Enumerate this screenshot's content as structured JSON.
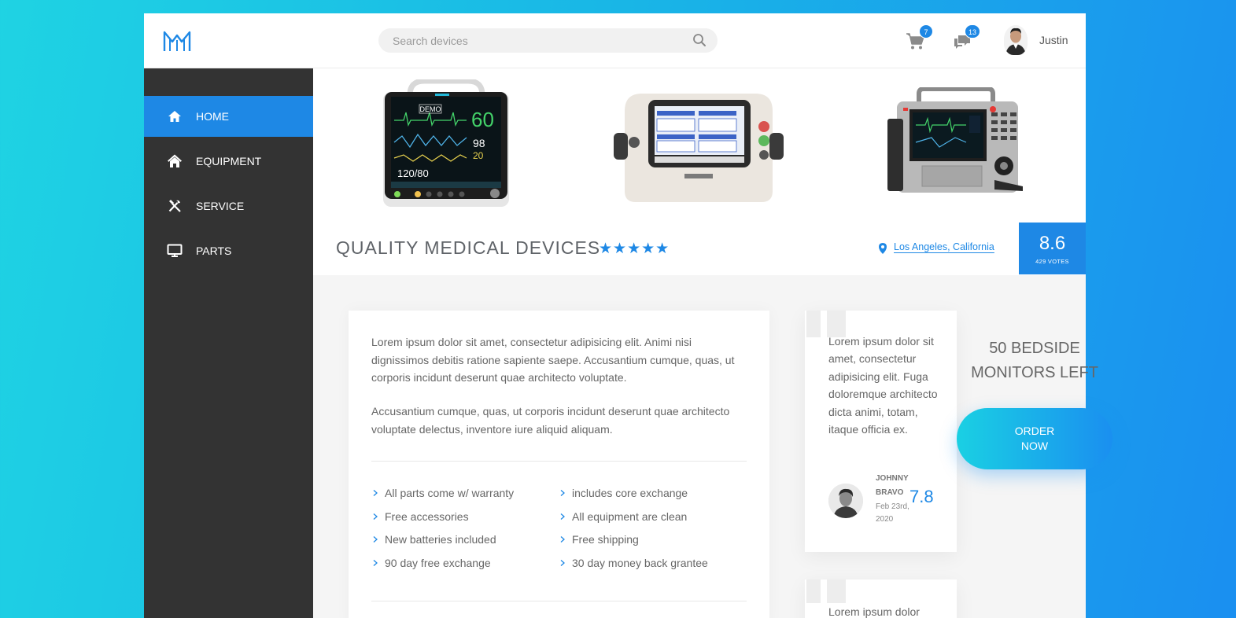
{
  "header": {
    "search_placeholder": "Search devices",
    "cart_count": "7",
    "messages_count": "13",
    "username": "Justin"
  },
  "sidebar": {
    "items": [
      {
        "label": "HOME",
        "icon": "home-icon",
        "active": true
      },
      {
        "label": "EQUIPMENT",
        "icon": "house-icon",
        "active": false
      },
      {
        "label": "SERVICE",
        "icon": "tools-icon",
        "active": false
      },
      {
        "label": "PARTS",
        "icon": "monitor-icon",
        "active": false
      }
    ]
  },
  "hero": {
    "devices": [
      "patient-monitor-image",
      "infusion-pump-image",
      "defibrillator-image"
    ],
    "monitor_readouts": {
      "label": "DEMO",
      "hr": "60",
      "spo2": "98",
      "resp": "20",
      "bp": "120/80"
    },
    "title": "QUALITY MEDICAL DEVICES",
    "stars": "★★★★★",
    "rating_value": 5,
    "location": "Los Angeles, California",
    "score": "8.6",
    "votes": "429 VOTES"
  },
  "main": {
    "paragraph1": "Lorem ipsum dolor sit amet, consectetur adipisicing elit. Animi nisi dignissimos debitis ratione sapiente saepe. Accusantium cumque, quas, ut corporis incidunt deserunt quae architecto voluptate.",
    "paragraph2": "Accusantium cumque, quas, ut corporis incidunt deserunt quae architecto voluptate delectus, inventore iure aliquid aliquam.",
    "features_left": [
      "All parts come w/ warranty",
      "Free accessories",
      "New batteries included",
      "90 day free exchange"
    ],
    "features_right": [
      "includes core exchange",
      "All equipment are clean",
      "Free shipping",
      "30 day money back grantee"
    ]
  },
  "review": {
    "text": "Lorem ipsum dolor sit amet, consectetur adipisicing elit. Fuga doloremque architecto dicta animi, totam, itaque officia ex.",
    "name": "JOHNNY BRAVO",
    "date": "Feb 23rd, 2020",
    "score": "7.8"
  },
  "review2": {
    "text": "Lorem ipsum dolor"
  },
  "aside": {
    "stock_line1": "50 BEDSIDE",
    "stock_line2": "MONITORS LEFT",
    "order_line1": "ORDER",
    "order_line2": "NOW"
  },
  "colors": {
    "accent": "#1e88e5",
    "sidebar": "#333333",
    "gradient_start": "#1ad0e3",
    "gradient_end": "#1a8ff0"
  }
}
